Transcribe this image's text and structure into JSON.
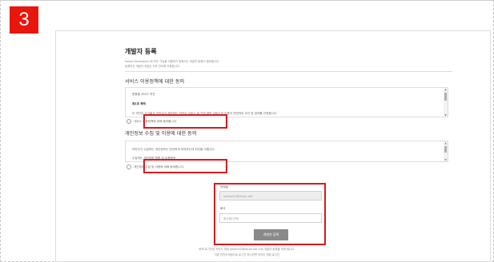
{
  "step_number": "3",
  "page": {
    "title": "개발자 등록",
    "intro": [
      "Kakao Developers 에 모든 기능을 이용하기 위해서는 개발자 등록이 필요합니다.",
      "등록하신 개발자 계정은 이후 관리에 사용됩니다."
    ]
  },
  "service_terms": {
    "heading": "서비스 이용정책에 대한 동의",
    "lines": [
      "응용을 서비스 약관",
      "제1조 목적",
      "이 약관은 주식회사 카카오가 제공하는 카카오 서비스 및 관련 제반 서비스의 이용과 관련하여 조건 및 절차를 규정합니다"
    ],
    "agree_label": "서비스 이용정책에 대해 동의합니다."
  },
  "privacy_terms": {
    "heading": "개인정보 수집 및 이용에 대한 동의",
    "lines": [
      "카카오가 수집하는 개인정보는 안전하게 처리하는데 최선을 다합니다.",
      "수집하는 개인정보 항목 및 이용목적"
    ],
    "agree_label": "개인정보 수집 및 이용에 대해 동의합니다."
  },
  "form": {
    "email_label": "이메일",
    "email_value": "apfsm02@daum.net",
    "company_label": "회사",
    "company_placeholder": "회사명(선택)",
    "register_button": "개발자 등록"
  },
  "footer": {
    "line1": "현재 로그인된 카카오 계정 apfsm02@daum.net 으로 개발자 등록을 하게 됩니다.",
    "line2": "다른 카카오계정으로 로그인 하시려면 카카오 계정 로그인"
  },
  "colors": {
    "highlight": "#d9191e",
    "badge": "#e8160c",
    "button": "#8a8a8a"
  }
}
